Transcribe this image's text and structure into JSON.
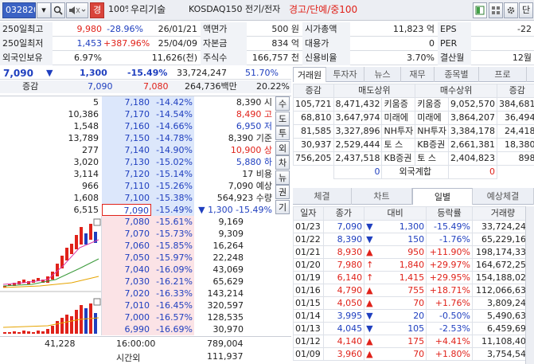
{
  "toolbar": {
    "code": "032820",
    "menu": "경",
    "zoom": "100%",
    "name": "우리기술",
    "market": "KOSDAQ150 전기/전자",
    "warning": "경고/단예/중100",
    "close": "단"
  },
  "info": {
    "row1": {
      "l1": "250일최고",
      "v1": "9,980",
      "p1": "-28.96%",
      "d1": "26/01/21",
      "l2": "액면가",
      "v2": "500 원",
      "l3": "시가총액",
      "v3": "11,823 억",
      "l4": "EPS",
      "v4": "-22"
    },
    "row2": {
      "l1": "250일최저",
      "v1": "1,453",
      "p1": "+387.96%",
      "d1": "25/04/09",
      "l2": "자본금",
      "v2": "834 억",
      "l3": "대용가",
      "v3": "0",
      "l4": "PER",
      "v4": ""
    },
    "row3": {
      "l1": "외국인보유",
      "v1": "6.97%",
      "p1": "11,626(천)",
      "l2": "주식수",
      "v2": "166,757 천",
      "l3": "신용비율",
      "v3": "3.70%",
      "l4": "결산월",
      "v4": "12월"
    }
  },
  "quote": {
    "price": "7,090",
    "change": "1,300",
    "rate": "-15.49%",
    "volume": "33,724,247",
    "vrate": "51.70%",
    "label": "증감",
    "p1": "7,090",
    "p2": "7,080",
    "amount": "264,736백만",
    "ratio": "20.22%"
  },
  "asks": [
    {
      "qty": "5",
      "price": "7,180",
      "rate": "-14.42%",
      "info": "8,390 시"
    },
    {
      "qty": "10,386",
      "price": "7,170",
      "rate": "-14.54%",
      "info": "8,490 고"
    },
    {
      "qty": "1,548",
      "price": "7,160",
      "rate": "-14.66%",
      "info": "6,950 저"
    },
    {
      "qty": "13,789",
      "price": "7,150",
      "rate": "-14.78%",
      "info": "8,390 기준"
    },
    {
      "qty": "277",
      "price": "7,140",
      "rate": "-14.90%",
      "info": "10,900 상"
    },
    {
      "qty": "3,020",
      "price": "7,130",
      "rate": "-15.02%",
      "info": "5,880 하"
    },
    {
      "qty": "3,114",
      "price": "7,120",
      "rate": "-15.14%",
      "info": "17 비용"
    },
    {
      "qty": "966",
      "price": "7,110",
      "rate": "-15.26%",
      "info": "7,090 예상"
    },
    {
      "qty": "1,608",
      "price": "7,100",
      "rate": "-15.38%",
      "info": "564,923 수량"
    },
    {
      "qty": "6,515",
      "price": "7,090",
      "rate": "-15.49%",
      "info": "▼ 1,300 -15.49%"
    }
  ],
  "side_buttons": [
    "수",
    "도",
    "투",
    "외",
    "차",
    "뉴",
    "권",
    "기"
  ],
  "bids": [
    {
      "price": "7,080",
      "rate": "-15.61%",
      "qty": "9,169"
    },
    {
      "price": "7,070",
      "rate": "-15.73%",
      "qty": "9,309"
    },
    {
      "price": "7,060",
      "rate": "-15.85%",
      "qty": "16,264"
    },
    {
      "price": "7,050",
      "rate": "-15.97%",
      "qty": "22,248"
    },
    {
      "price": "7,040",
      "rate": "-16.09%",
      "qty": "43,069"
    },
    {
      "price": "7,030",
      "rate": "-16.21%",
      "qty": "65,629"
    },
    {
      "price": "7,020",
      "rate": "-16.33%",
      "qty": "143,214"
    },
    {
      "price": "7,010",
      "rate": "-16.45%",
      "qty": "320,597"
    },
    {
      "price": "7,000",
      "rate": "-16.57%",
      "qty": "128,535"
    },
    {
      "price": "6,990",
      "rate": "-16.69%",
      "qty": "30,970"
    }
  ],
  "totals": {
    "ask_total": "41,228",
    "time": "16:00:00",
    "bid_total": "789,004",
    "after_label": "시간외",
    "after_qty": "111,937"
  },
  "tabs1": [
    "거래원",
    "투자자",
    "뉴스",
    "재무",
    "종목별",
    "프로"
  ],
  "brokers": {
    "headers": [
      "증감",
      "매도상위",
      "매수상위",
      "증감"
    ],
    "rows": [
      {
        "d1": "105,721",
        "sv": "8,471,432",
        "sn": "키움증",
        "bn": "키움증",
        "bv": "9,052,570",
        "d2": "384,681"
      },
      {
        "d1": "68,810",
        "sv": "3,647,974",
        "sn": "미래에",
        "bn": "미래에",
        "bv": "3,864,207",
        "d2": "36,494"
      },
      {
        "d1": "81,585",
        "sv": "3,327,896",
        "sn": "NH투자",
        "bn": "NH투자",
        "bv": "3,384,178",
        "d2": "24,418"
      },
      {
        "d1": "30,937",
        "sv": "2,529,444",
        "sn": "토 스",
        "bn": "KB증권",
        "bv": "2,661,381",
        "d2": "18,380"
      },
      {
        "d1": "756,205",
        "sv": "2,437,518",
        "sn": "KB증권",
        "bn": "토 스",
        "bv": "2,404,823",
        "d2": "898"
      }
    ],
    "foreign": {
      "d1": "0",
      "label": "외국계합",
      "d2": "0"
    }
  },
  "tabs2": [
    "체결",
    "차트",
    "일별",
    "예상체결"
  ],
  "daily": {
    "headers": [
      "일자",
      "종가",
      "대비",
      "등락률",
      "거래량"
    ],
    "rows": [
      {
        "date": "01/23",
        "close": "7,090",
        "mark": "▼",
        "diff": "1,300",
        "rate": "-15.49%",
        "vol": "33,724,247",
        "dir": "down"
      },
      {
        "date": "01/22",
        "close": "8,390",
        "mark": "▼",
        "diff": "150",
        "rate": "-1.76%",
        "vol": "65,229,168",
        "dir": "down"
      },
      {
        "date": "01/21",
        "close": "8,930",
        "mark": "▲",
        "diff": "950",
        "rate": "+11.90%",
        "vol": "198,174,331",
        "dir": "up"
      },
      {
        "date": "01/20",
        "close": "7,980",
        "mark": "↑",
        "diff": "1,840",
        "rate": "+29.97%",
        "vol": "164,672,257",
        "dir": "up"
      },
      {
        "date": "01/19",
        "close": "6,140",
        "mark": "↑",
        "diff": "1,415",
        "rate": "+29.95%",
        "vol": "154,188,027",
        "dir": "up"
      },
      {
        "date": "01/16",
        "close": "4,790",
        "mark": "▲",
        "diff": "755",
        "rate": "+18.71%",
        "vol": "112,066,638",
        "dir": "up"
      },
      {
        "date": "01/15",
        "close": "4,050",
        "mark": "▲",
        "diff": "70",
        "rate": "+1.76%",
        "vol": "3,809,242",
        "dir": "up"
      },
      {
        "date": "01/14",
        "close": "3,995",
        "mark": "▼",
        "diff": "20",
        "rate": "-0.50%",
        "vol": "5,490,633",
        "dir": "down"
      },
      {
        "date": "01/13",
        "close": "4,045",
        "mark": "▼",
        "diff": "105",
        "rate": "-2.53%",
        "vol": "6,459,694",
        "dir": "down"
      },
      {
        "date": "01/12",
        "close": "4,140",
        "mark": "▲",
        "diff": "175",
        "rate": "+4.41%",
        "vol": "11,108,401",
        "dir": "up"
      },
      {
        "date": "01/09",
        "close": "3,960",
        "mark": "▲",
        "diff": "70",
        "rate": "+1.80%",
        "vol": "3,754,542",
        "dir": "up"
      }
    ]
  },
  "colors": {
    "up": "#e0221a",
    "down": "#1f3fbf",
    "ask_bg": "#dce7fb",
    "bid_bg": "#fbe3e6",
    "header_bg": "#f1f3f7"
  }
}
